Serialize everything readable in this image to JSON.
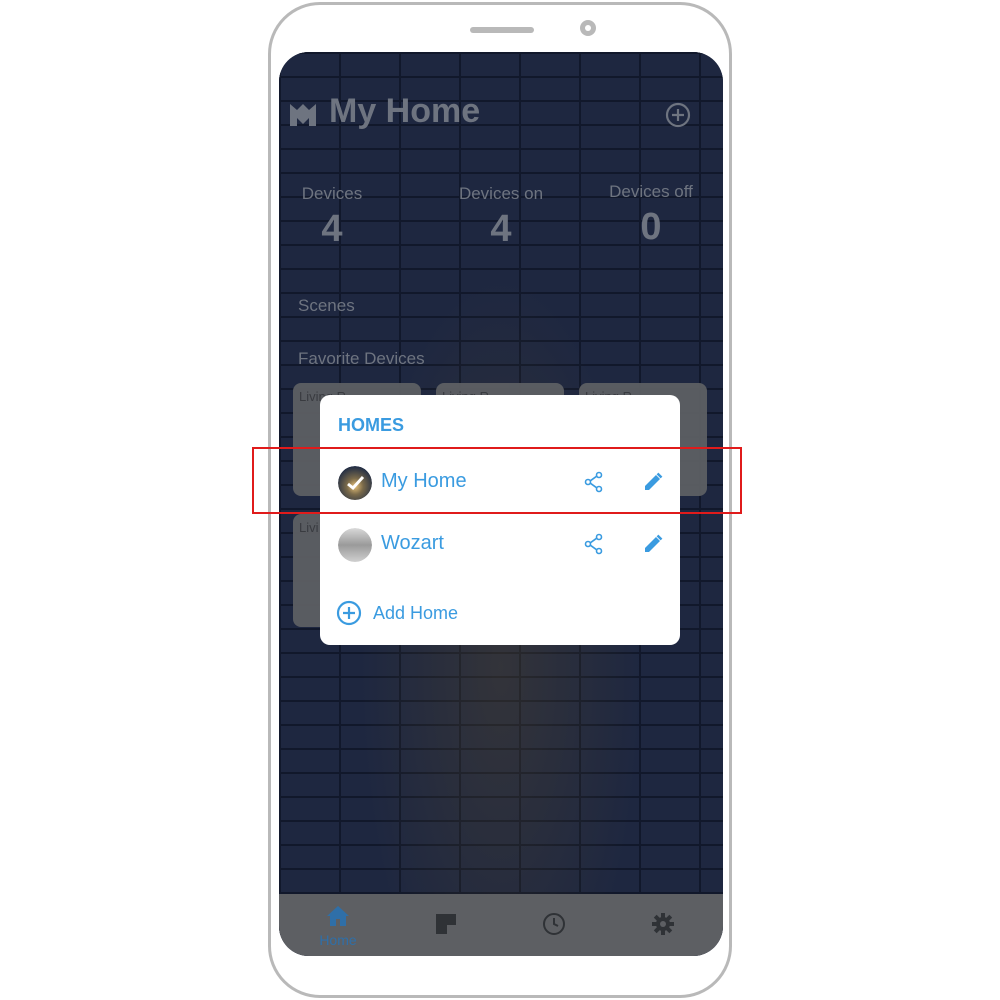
{
  "app": {
    "title": "My Home"
  },
  "stats": [
    {
      "label": "Devices",
      "value": "4"
    },
    {
      "label": "Devices on",
      "value": "4"
    },
    {
      "label": "Devices off",
      "value": "0"
    }
  ],
  "sections": {
    "scenes": "Scenes",
    "favorites": "Favorite Devices"
  },
  "favorite_cards": [
    {
      "label": "Living R"
    },
    {
      "label": "Living R"
    },
    {
      "label": "Living R"
    },
    {
      "label": "Livi"
    }
  ],
  "popup": {
    "title": "HOMES",
    "homes": [
      {
        "name": "My Home"
      },
      {
        "name": "Wozart"
      }
    ],
    "add_label": "Add Home"
  },
  "nav": {
    "home_label": "Home"
  },
  "colors": {
    "accent": "#3a9be0",
    "highlight": "#e01b1b",
    "nav_active": "#2f6fa8"
  },
  "icons": [
    "logo-icon",
    "add-circle-icon",
    "share-icon",
    "edit-pencil-icon",
    "home-icon",
    "dashboard-icon",
    "clock-icon",
    "gear-icon"
  ]
}
